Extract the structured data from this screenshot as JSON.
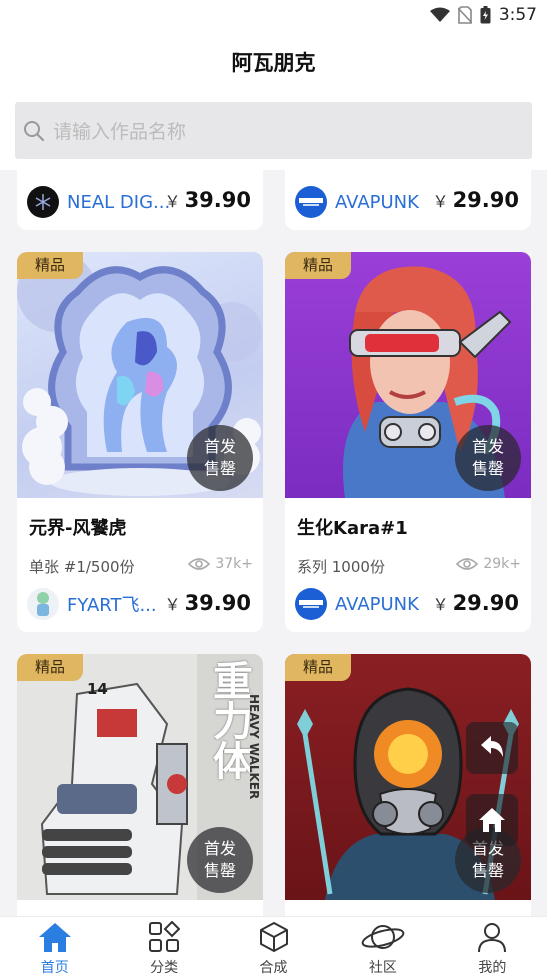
{
  "status_bar": {
    "time": "3:57"
  },
  "header": {
    "title": "阿瓦朋克"
  },
  "search": {
    "placeholder": "请输入作品名称"
  },
  "feed": {
    "top_cards": [
      {
        "author": "NEAL DIG...",
        "currency": "￥",
        "price": "39.90"
      },
      {
        "author": "AVAPUNK",
        "currency": "￥",
        "price": "29.90"
      }
    ],
    "cards": [
      {
        "badge": "精品",
        "first_sale": [
          "首发",
          "售罄"
        ],
        "title": "元界-风饕虎",
        "meta": "单张 #1/500份",
        "views": "37k+",
        "author": "FYART飞...",
        "currency": "￥",
        "price": "39.90"
      },
      {
        "badge": "精品",
        "first_sale": [
          "首发",
          "售罄"
        ],
        "title": "生化Kara#1",
        "meta": "系列 1000份",
        "views": "29k+",
        "author": "AVAPUNK",
        "currency": "￥",
        "price": "29.90"
      },
      {
        "badge": "精品",
        "first_sale": [
          "首发",
          "售罄"
        ],
        "art_text": [
          "重力体",
          "HEAVY WALKER",
          "14"
        ]
      },
      {
        "badge": "精品",
        "first_sale": [
          "首发",
          "售罄"
        ]
      }
    ]
  },
  "tabs": [
    {
      "label": "首页",
      "icon": "home-icon",
      "active": true
    },
    {
      "label": "分类",
      "icon": "grid-icon",
      "active": false
    },
    {
      "label": "合成",
      "icon": "cube-icon",
      "active": false
    },
    {
      "label": "社区",
      "icon": "planet-icon",
      "active": false
    },
    {
      "label": "我的",
      "icon": "user-icon",
      "active": false
    }
  ],
  "colors": {
    "accent": "#2a7de1",
    "badge": "#e0b660",
    "price": "#111111"
  }
}
